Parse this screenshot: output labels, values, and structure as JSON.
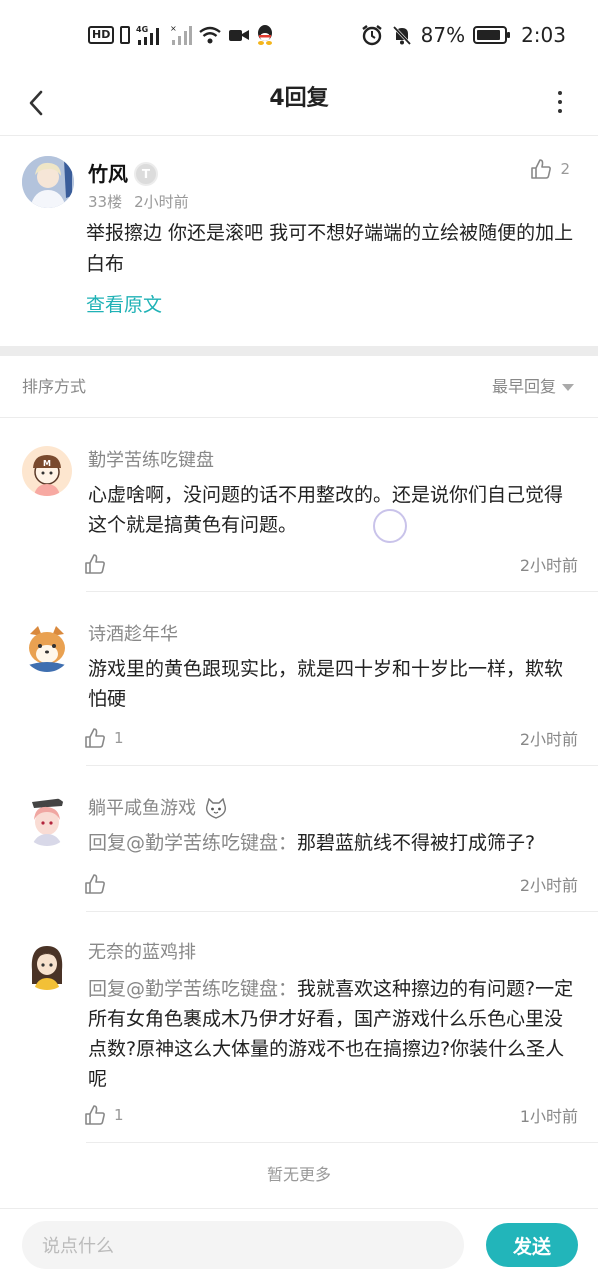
{
  "status_bar": {
    "left_icons": [
      "hd-icon",
      "sim-icon",
      "4g-signal-icon",
      "signal-icon",
      "wifi-icon",
      "video-icon",
      "qq-icon"
    ],
    "network": "4G",
    "battery_percent": "87%",
    "battery_level": 0.87,
    "time": "2:03"
  },
  "header": {
    "title": "4回复"
  },
  "post": {
    "author": "竹风",
    "level_badge": "T",
    "floor": "33楼",
    "time": "2小时前",
    "like_count": "2",
    "body": "举报擦边  你还是滚吧  我可不想好端端的立绘被随便的加上白布",
    "view_original": "查看原文"
  },
  "sort": {
    "label": "排序方式",
    "selected": "最早回复"
  },
  "replies": [
    {
      "author": "勤学苦练吃键盘",
      "body": "心虚啥啊，没问题的话不用整改的。还是说你们自己觉得这个就是搞黄色有问题。",
      "mention": "",
      "likes": "",
      "time": "2小时前"
    },
    {
      "author": "诗酒趁年华",
      "body": "游戏里的黄色跟现实比，就是四十岁和十岁比一样，欺软怕硬",
      "mention": "",
      "likes": "1",
      "time": "2小时前"
    },
    {
      "author": "躺平咸鱼游戏",
      "mention": "回复@勤学苦练吃键盘：",
      "body": "那碧蓝航线不得被打成筛子?",
      "likes": "",
      "time": "2小时前"
    },
    {
      "author": "无奈的蓝鸡排",
      "mention": "回复@勤学苦练吃键盘：",
      "body": "我就喜欢这种擦边的有问题?一定所有女角色裹成木乃伊才好看，国产游戏什么乐色心里没点数?原神这么大体量的游戏不也在搞擦边?你装什么圣人呢",
      "likes": "1",
      "time": "1小时前"
    }
  ],
  "footer": {
    "no_more": "暂无更多"
  },
  "input_bar": {
    "placeholder": "说点什么",
    "send_label": "发送"
  },
  "colors": {
    "accent": "#22b5ba",
    "link": "#20b2b6"
  }
}
